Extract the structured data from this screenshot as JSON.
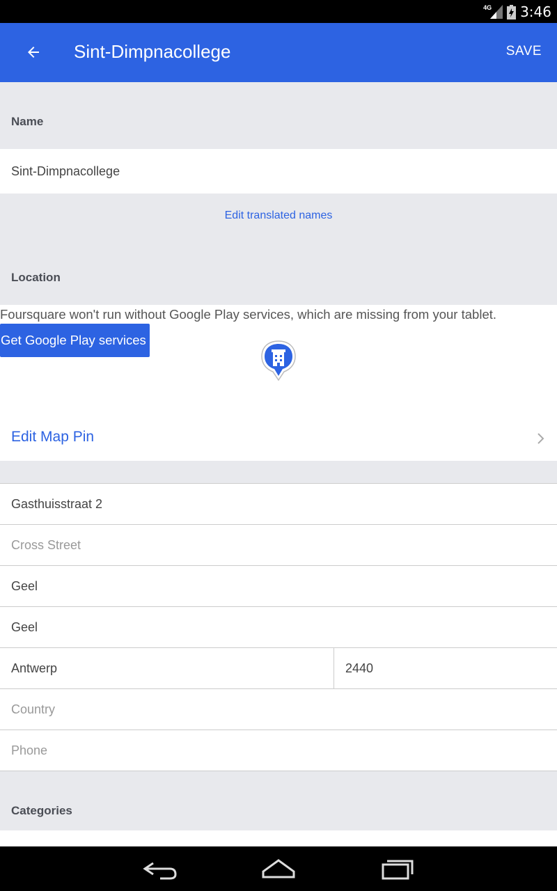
{
  "status_bar": {
    "time": "3:46",
    "network_label": "4G",
    "icons": [
      "signal-icon",
      "battery-icon"
    ]
  },
  "toolbar": {
    "title": "Sint-Dimpnacollege",
    "save_label": "SAVE",
    "back_icon": "arrow-left-icon"
  },
  "name_section": {
    "header": "Name",
    "value": "Sint-Dimpnacollege",
    "edit_translated_label": "Edit translated names"
  },
  "location_section": {
    "header": "Location",
    "gps_message": "Foursquare won't run without Google Play services, which are missing from your tablet.",
    "gps_button_label": "Get Google Play services",
    "pin_icon": "building-pin-icon",
    "edit_map_pin_label": "Edit Map Pin"
  },
  "address": {
    "street": "Gasthuisstraat 2",
    "cross_street_placeholder": "Cross Street",
    "city": "Geel",
    "municipality": "Geel",
    "state": "Antwerp",
    "postal_code": "2440",
    "country_placeholder": "Country",
    "phone_placeholder": "Phone"
  },
  "categories_section": {
    "header": "Categories"
  },
  "colors": {
    "accent": "#2d63e2",
    "background": "#e8e9ed",
    "status_bar": "#000000"
  },
  "nav_bar": {
    "icons": [
      "back-nav-icon",
      "home-nav-icon",
      "recents-nav-icon"
    ]
  }
}
